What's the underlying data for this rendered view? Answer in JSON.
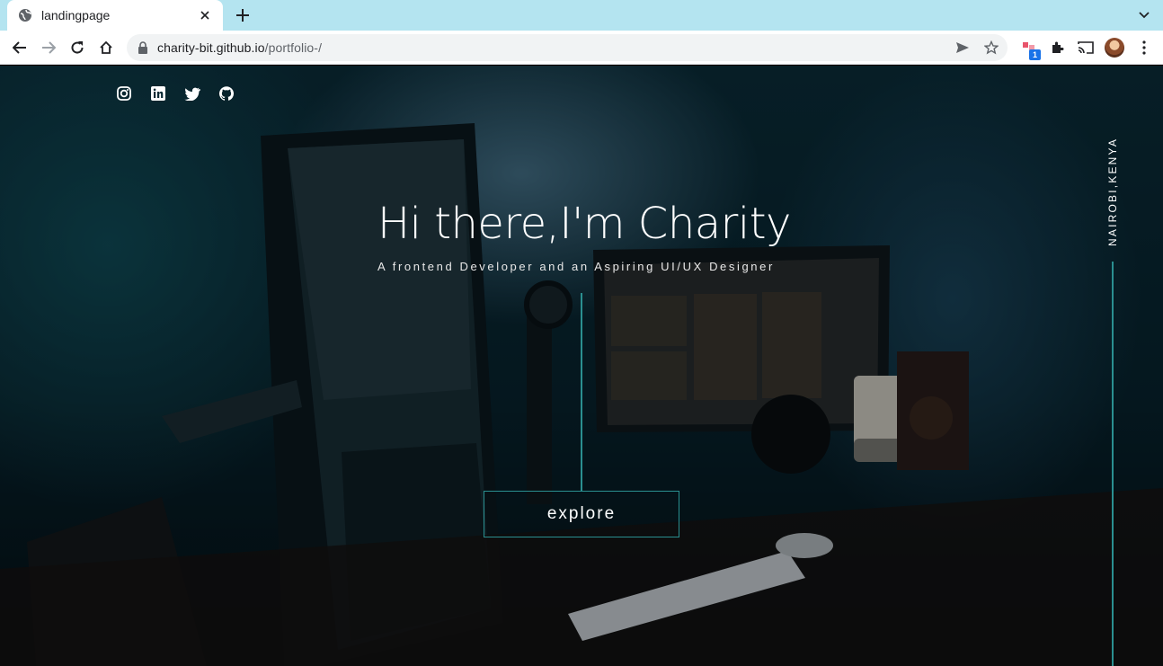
{
  "browser": {
    "tab_title": "landingpage",
    "url_host": "charity-bit.github.io",
    "url_path": "/portfolio-/",
    "extension_badge": "1"
  },
  "social": [
    "instagram-icon",
    "linkedin-icon",
    "twitter-icon",
    "github-icon"
  ],
  "hero": {
    "title": "Hi there,I'm Charity",
    "subtitle": "A frontend Developer and an Aspiring UI/UX Designer",
    "cta_label": "explore"
  },
  "location": "NAIROBI,KENYA",
  "colors": {
    "accent": "#2a8f90",
    "tabbar": "#b4e4f0",
    "text": "#ffffff"
  }
}
